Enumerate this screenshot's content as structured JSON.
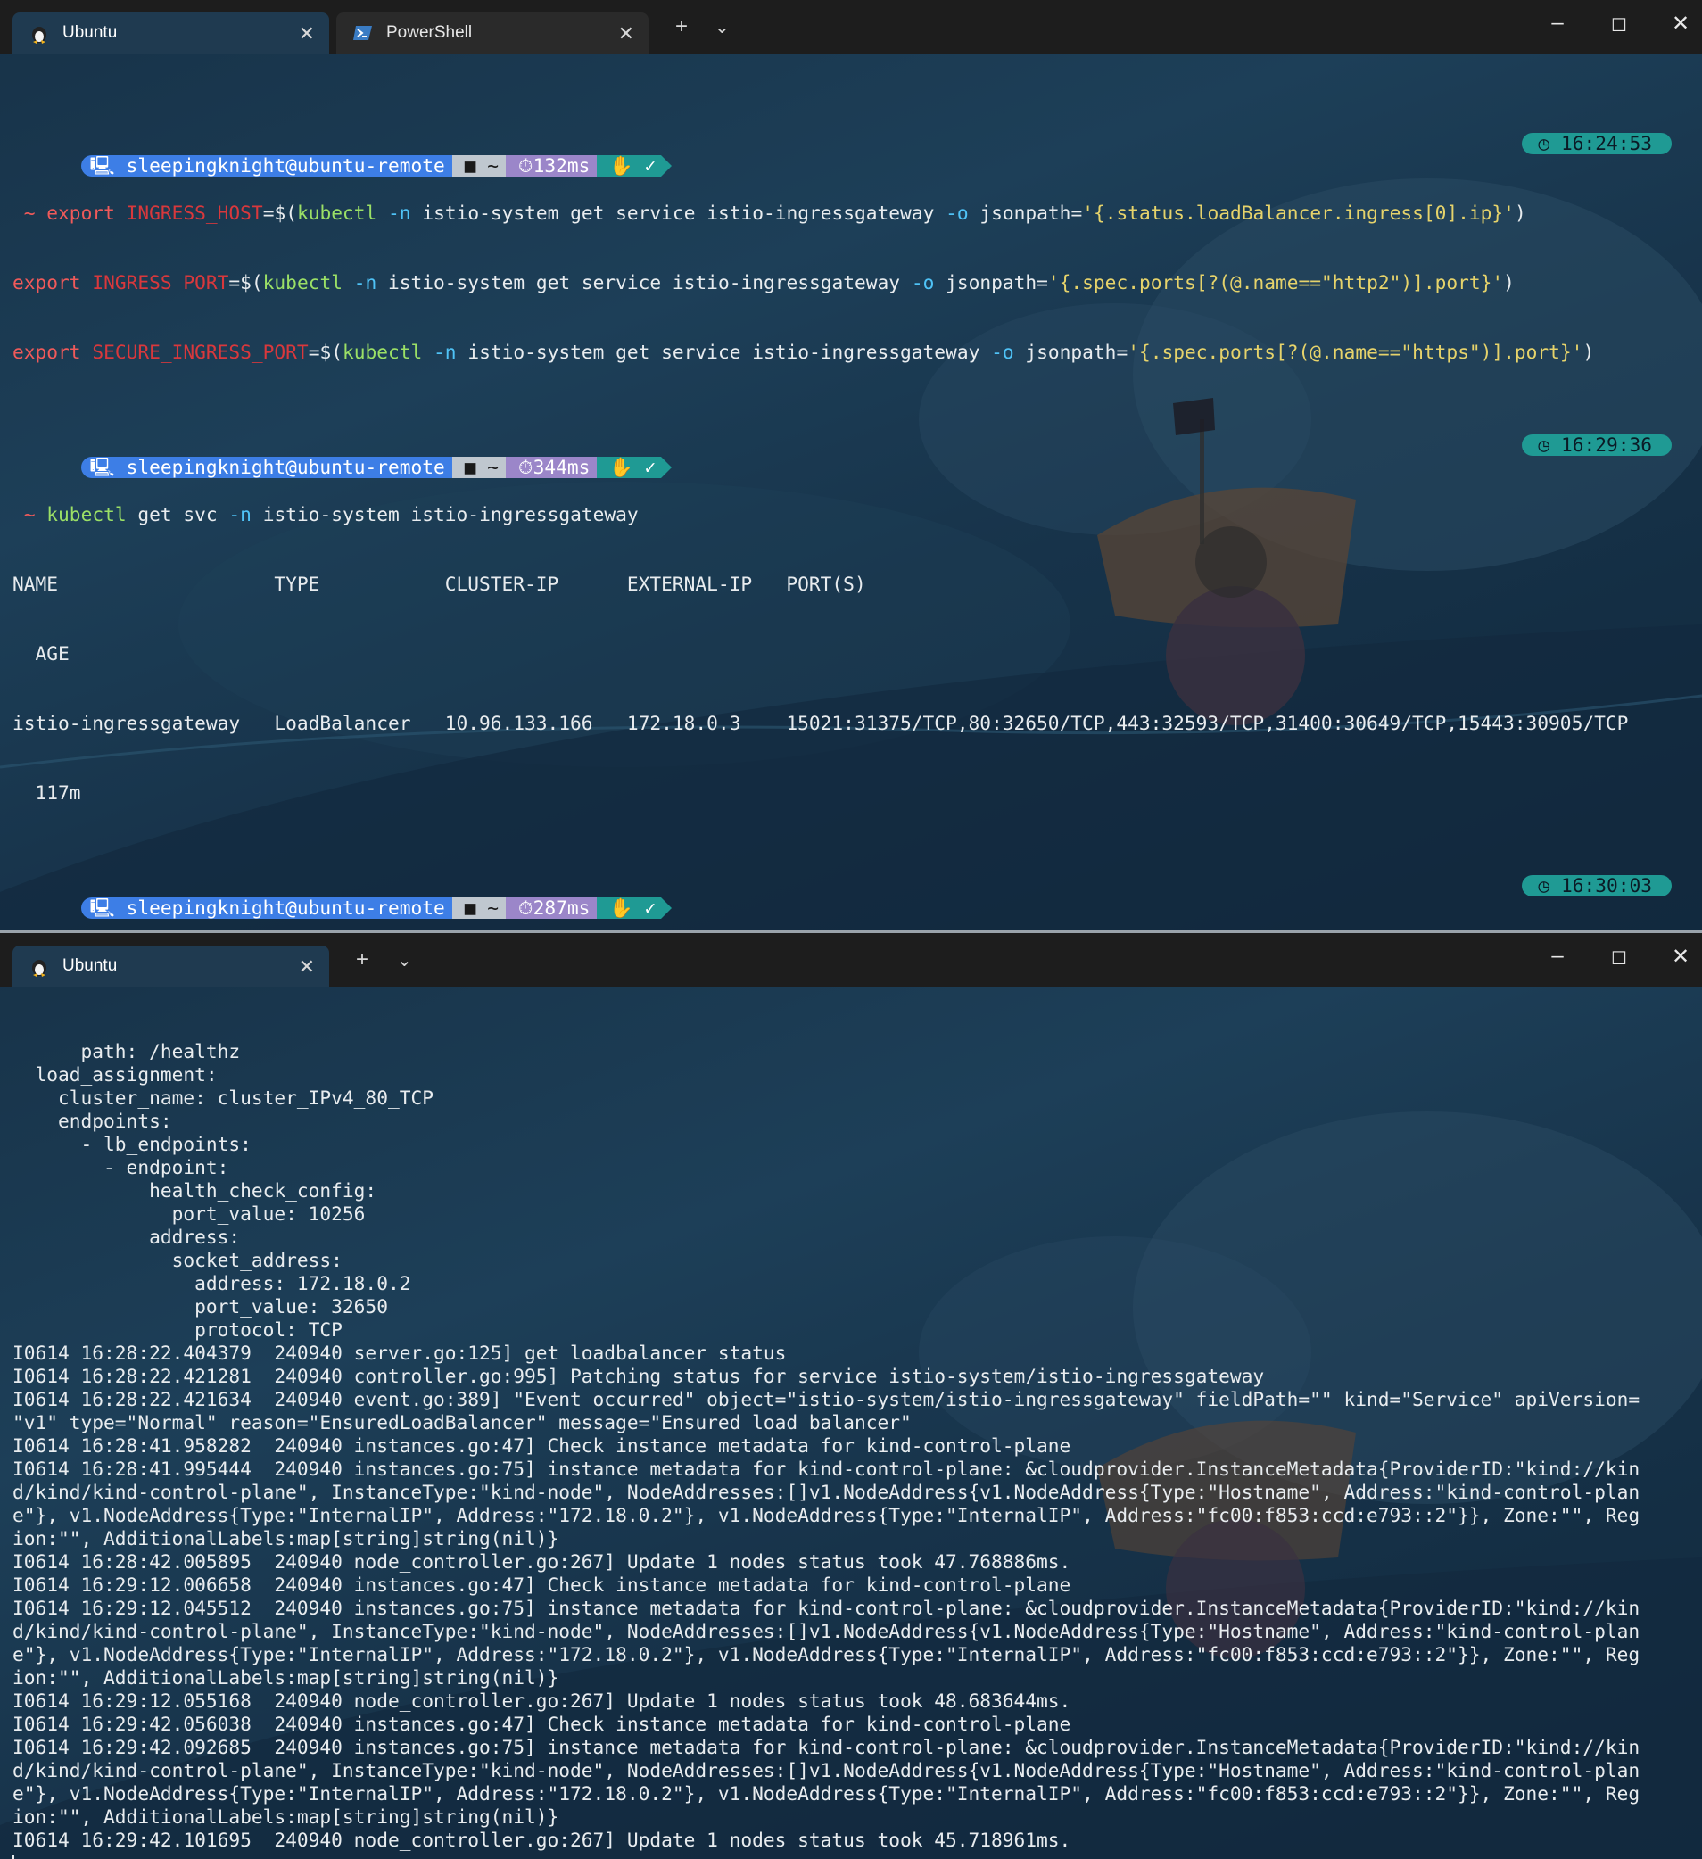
{
  "top_window": {
    "tabs": [
      {
        "label": "Ubuntu",
        "icon": "linux-penguin-icon"
      },
      {
        "label": "PowerShell",
        "icon": "powershell-icon"
      }
    ],
    "new_tab_symbol": "+",
    "dropdown_symbol": "⌄",
    "prompts": [
      {
        "user": "sleepingknight@ubuntu-remote",
        "path": "~",
        "duration": "132ms",
        "clock": "16:24:53"
      },
      {
        "user": "sleepingknight@ubuntu-remote",
        "path": "~",
        "duration": "344ms",
        "clock": "16:29:36"
      },
      {
        "user": "sleepingknight@ubuntu-remote",
        "path": "~",
        "duration": "287ms",
        "clock": "16:30:03"
      }
    ],
    "cmd1": {
      "l1": {
        "kw": "export",
        "var": "INGRESS_HOST",
        "eq": "=$(",
        "cmd": "kubectl",
        "f1": "-n",
        "a1": "istio-system get service istio-ingressgateway",
        "f2": "-o",
        "a2": "jsonpath=",
        "str": "'{.status.loadBalancer.ingress[0].ip}'",
        "end": ")"
      },
      "l2": {
        "kw": "export",
        "var": "INGRESS_PORT",
        "eq": "=$(",
        "cmd": "kubectl",
        "f1": "-n",
        "a1": "istio-system get service istio-ingressgateway",
        "f2": "-o",
        "a2": "jsonpath=",
        "str": "'{.spec.ports[?(@.name==\"http2\")].port}'",
        "end": ")"
      },
      "l3": {
        "kw": "export",
        "var": "SECURE_INGRESS_PORT",
        "eq": "=$(",
        "cmd": "kubectl",
        "f1": "-n",
        "a1": "istio-system get service istio-ingressgateway",
        "f2": "-o",
        "a2": "jsonpath=",
        "str": "'{.spec.ports[?(@.name==\"https\")].port}'",
        "end": ")"
      }
    },
    "cmd2": {
      "cmd": "kubectl",
      "a1": "get svc",
      "f1": "-n",
      "a2": "istio-system istio-ingressgateway"
    },
    "svc_table": {
      "header": "NAME                   TYPE           CLUSTER-IP      EXTERNAL-IP   PORT(S)",
      "header_wrap": "  AGE",
      "row": "istio-ingressgateway   LoadBalancer   10.96.133.166   172.18.0.3    15021:31375/TCP,80:32650/TCP,443:32593/TCP,31400:30649/TCP,15443:30905/TCP",
      "row_wrap": "  117m"
    }
  },
  "bottom_window": {
    "tabs": [
      {
        "label": "Ubuntu",
        "icon": "linux-penguin-icon"
      }
    ],
    "new_tab_symbol": "+",
    "dropdown_symbol": "⌄",
    "lines": [
      "      path: /healthz",
      "  load_assignment:",
      "    cluster_name: cluster_IPv4_80_TCP",
      "    endpoints:",
      "      - lb_endpoints:",
      "        - endpoint:",
      "            health_check_config:",
      "              port_value: 10256",
      "            address:",
      "              socket_address:",
      "                address: 172.18.0.2",
      "                port_value: 32650",
      "                protocol: TCP",
      "I0614 16:28:22.404379  240940 server.go:125] get loadbalancer status",
      "I0614 16:28:22.421281  240940 controller.go:995] Patching status for service istio-system/istio-ingressgateway",
      "I0614 16:28:22.421634  240940 event.go:389] \"Event occurred\" object=\"istio-system/istio-ingressgateway\" fieldPath=\"\" kind=\"Service\" apiVersion=",
      "\"v1\" type=\"Normal\" reason=\"EnsuredLoadBalancer\" message=\"Ensured load balancer\"",
      "I0614 16:28:41.958282  240940 instances.go:47] Check instance metadata for kind-control-plane",
      "I0614 16:28:41.995444  240940 instances.go:75] instance metadata for kind-control-plane: &cloudprovider.InstanceMetadata{ProviderID:\"kind://kin",
      "d/kind/kind-control-plane\", InstanceType:\"kind-node\", NodeAddresses:[]v1.NodeAddress{v1.NodeAddress{Type:\"Hostname\", Address:\"kind-control-plan",
      "e\"}, v1.NodeAddress{Type:\"InternalIP\", Address:\"172.18.0.2\"}, v1.NodeAddress{Type:\"InternalIP\", Address:\"fc00:f853:ccd:e793::2\"}}, Zone:\"\", Reg",
      "ion:\"\", AdditionalLabels:map[string]string(nil)}",
      "I0614 16:28:42.005895  240940 node_controller.go:267] Update 1 nodes status took 47.768886ms.",
      "I0614 16:29:12.006658  240940 instances.go:47] Check instance metadata for kind-control-plane",
      "I0614 16:29:12.045512  240940 instances.go:75] instance metadata for kind-control-plane: &cloudprovider.InstanceMetadata{ProviderID:\"kind://kin",
      "d/kind/kind-control-plane\", InstanceType:\"kind-node\", NodeAddresses:[]v1.NodeAddress{v1.NodeAddress{Type:\"Hostname\", Address:\"kind-control-plan",
      "e\"}, v1.NodeAddress{Type:\"InternalIP\", Address:\"172.18.0.2\"}, v1.NodeAddress{Type:\"InternalIP\", Address:\"fc00:f853:ccd:e793::2\"}}, Zone:\"\", Reg",
      "ion:\"\", AdditionalLabels:map[string]string(nil)}",
      "I0614 16:29:12.055168  240940 node_controller.go:267] Update 1 nodes status took 48.683644ms.",
      "I0614 16:29:42.056038  240940 instances.go:47] Check instance metadata for kind-control-plane",
      "I0614 16:29:42.092685  240940 instances.go:75] instance metadata for kind-control-plane: &cloudprovider.InstanceMetadata{ProviderID:\"kind://kin",
      "d/kind/kind-control-plane\", InstanceType:\"kind-node\", NodeAddresses:[]v1.NodeAddress{v1.NodeAddress{Type:\"Hostname\", Address:\"kind-control-plan",
      "e\"}, v1.NodeAddress{Type:\"InternalIP\", Address:\"172.18.0.2\"}, v1.NodeAddress{Type:\"InternalIP\", Address:\"fc00:f853:ccd:e793::2\"}}, Zone:\"\", Reg",
      "ion:\"\", AdditionalLabels:map[string]string(nil)}",
      "I0614 16:29:42.101695  240940 node_controller.go:267] Update 1 nodes status took 45.718961ms."
    ]
  },
  "colors": {
    "user_segment": "#3d7ee6",
    "path_segment": "#bfc7cf",
    "time_segment": "#9b86c9",
    "status_segment": "#1f9a94",
    "keyword": "#f05a5a",
    "command": "#9be066",
    "flag": "#4fc3f7",
    "string": "#e6d36b"
  }
}
